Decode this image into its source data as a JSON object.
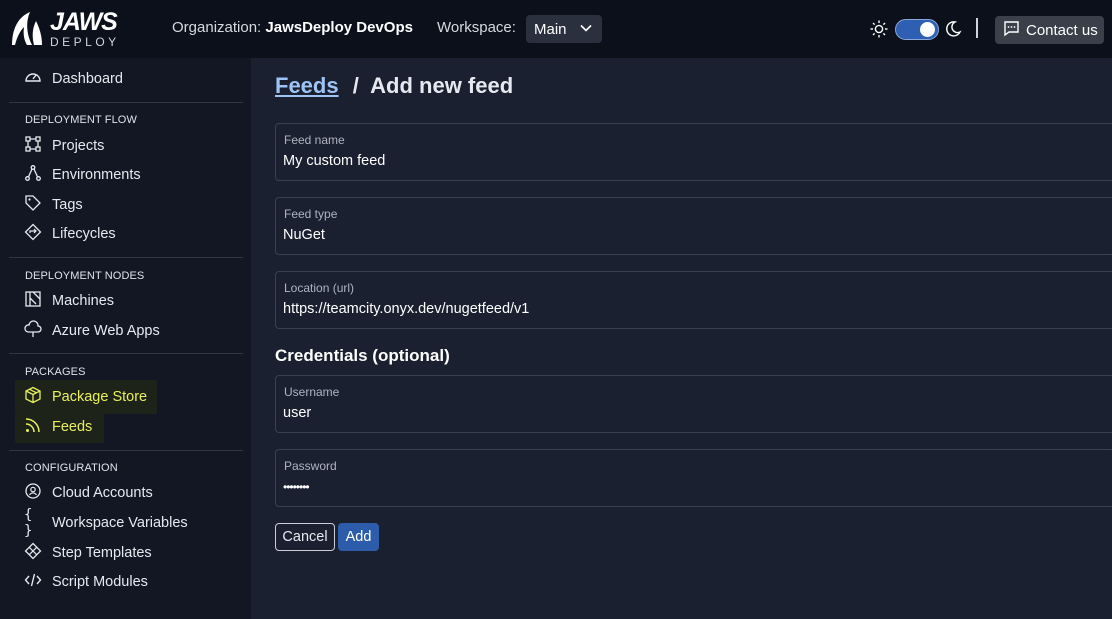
{
  "brand": {
    "logo_line1": "JAWS",
    "logo_line2": "DEPLOY"
  },
  "header": {
    "organization_label": "Organization:",
    "organization_value": "JawsDeploy DevOps",
    "workspace_label": "Workspace:",
    "workspace_value": "Main",
    "theme_toggle_on": true,
    "contact_label": "Contact us"
  },
  "sidebar": {
    "dashboard": "Dashboard",
    "sections": [
      {
        "title": "DEPLOYMENT FLOW",
        "items": [
          "Projects",
          "Environments",
          "Tags",
          "Lifecycles"
        ]
      },
      {
        "title": "DEPLOYMENT NODES",
        "items": [
          "Machines",
          "Azure Web Apps"
        ]
      },
      {
        "title": "PACKAGES",
        "items": [
          "Package Store",
          "Feeds"
        ]
      },
      {
        "title": "CONFIGURATION",
        "items": [
          "Cloud Accounts",
          "Workspace Variables",
          "Step Templates",
          "Script Modules"
        ]
      }
    ],
    "highlight_color": "#e8f05a"
  },
  "main": {
    "breadcrumb_link": "Feeds",
    "breadcrumb_sep": "/",
    "page_title": "Add new feed",
    "fields": [
      {
        "label": "Feed name",
        "value": "My custom feed"
      },
      {
        "label": "Feed type",
        "value": "NuGet"
      },
      {
        "label": "Location (url)",
        "value": "https://teamcity.onyx.dev/nugetfeed/v1"
      }
    ],
    "credentials_title": "Credentials (optional)",
    "credential_fields": [
      {
        "label": "Username",
        "value": "user"
      },
      {
        "label": "Password",
        "value": "••••••••"
      }
    ],
    "cancel_label": "Cancel",
    "add_label": "Add"
  }
}
